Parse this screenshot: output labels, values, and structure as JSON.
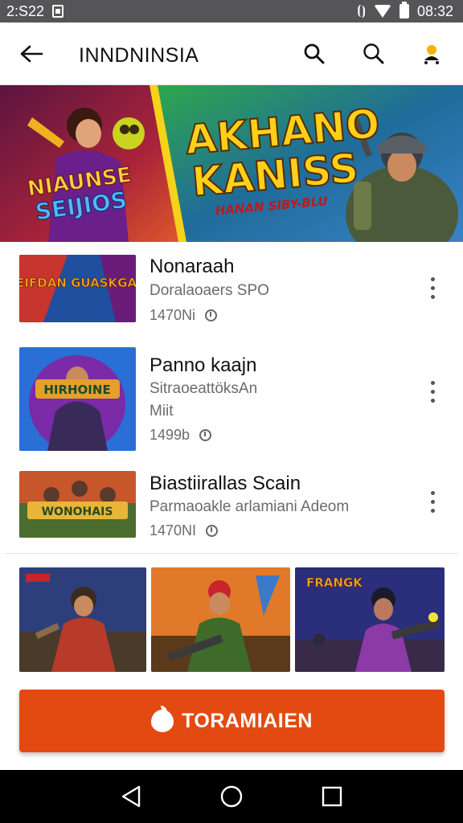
{
  "status_bar": {
    "time": "2:S22",
    "clock": "08:32"
  },
  "app_bar": {
    "title": "INNDNINSIA"
  },
  "banner": {
    "left_text_1": "NIAUNSE",
    "left_text_2": "SEIJIOS",
    "big_line_1": "AKHANO",
    "big_line_2": "KANISS",
    "tagline": "HANAN SIBY-BLU"
  },
  "list": {
    "items": [
      {
        "title": "Nonaraah",
        "subtitle": "Doralaoaers SPO",
        "subtitle2": "",
        "meta": "1470Ni",
        "thumb_text": "SEIFDAN GUASKGAN",
        "colors": [
          "#1f4f9e",
          "#c8342e",
          "#f2a51e"
        ]
      },
      {
        "title": "Panno kaajn",
        "subtitle": "SitraoeattöksAn",
        "subtitle2": "Miit",
        "meta": "1499b",
        "thumb_text": "HIRHOINE",
        "colors": [
          "#2a6fd6",
          "#7b2aa8",
          "#e3a02a"
        ]
      },
      {
        "title": "Biastiirallas Scain",
        "subtitle": "Parmaoakle arlamiani Adeom",
        "subtitle2": "",
        "meta": "1470NI",
        "thumb_text": "WONOHAIS",
        "colors": [
          "#c6572a",
          "#4b6d2f",
          "#e8b53a"
        ]
      }
    ]
  },
  "gallery": {
    "tiles": [
      {
        "caption": "",
        "colors": [
          "#2d3f7a",
          "#b83a2b"
        ]
      },
      {
        "caption": "",
        "colors": [
          "#a44a1f",
          "#3e6a2a"
        ]
      },
      {
        "caption": "FRANGK",
        "colors": [
          "#2b2e7a",
          "#8b3aa8"
        ]
      }
    ]
  },
  "cta": {
    "label": "TORAMIAIEN"
  },
  "colors": {
    "accent": "#e24a12",
    "status_bar": "#555557",
    "nav_bar": "#000000"
  }
}
